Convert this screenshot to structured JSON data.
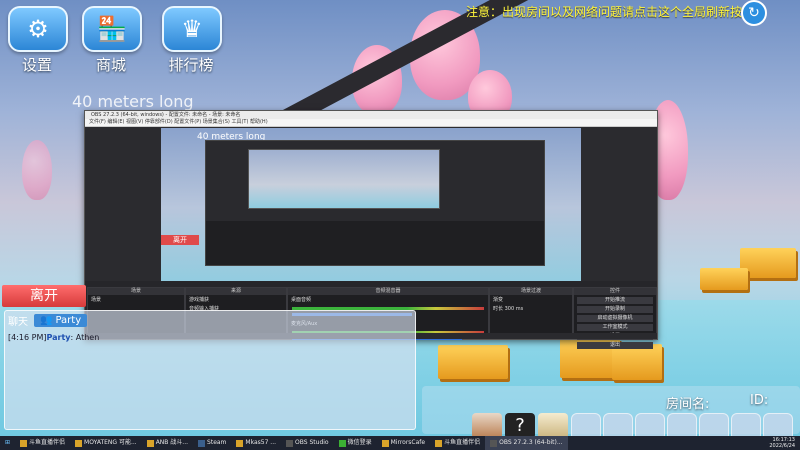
{
  "top_buttons": [
    {
      "label": "设置",
      "icon": "gear-icon"
    },
    {
      "label": "商城",
      "icon": "shop-icon"
    },
    {
      "label": "排行榜",
      "icon": "crown-icon"
    }
  ],
  "notice": "注意：出现房间以及网络问题请点击这个全局刷新按钮",
  "background_text": "40 meters long",
  "obs": {
    "title": "OBS 27.2.3 (64-bit, windows) - 配置文件: 未命名 - 场景: 未命名",
    "menu": "文件(F)  编辑(E)  视图(V)  停靠部件(D)  配置文件(P)  场景集合(S)  工具(T)  帮助(H)",
    "inner_bg_text": "40 meters long",
    "leave_small": "离开",
    "docks": {
      "scenes_title": "场景",
      "scene_item": "场景",
      "sources_title": "来源",
      "source_items": [
        "游戏捕获",
        "音频输入捕获"
      ],
      "mixer_title": "音频混音器",
      "mixer_items": [
        "桌面音频",
        "麦克风/Aux"
      ],
      "transitions_title": "场景过渡",
      "transition_type": "渐变",
      "duration_label": "时长",
      "duration_value": "300 ms",
      "controls_title": "控件",
      "control_buttons": [
        "开始推流",
        "开始录制",
        "启动虚拟摄像机",
        "工作室模式",
        "设置",
        "退出"
      ]
    }
  },
  "chat": {
    "leave_label": "离开",
    "tab_chat": "聊天",
    "tab_party": "Party",
    "message_time": "[4:16 PM]",
    "message_channel": "Party",
    "message_text": ": Athen"
  },
  "room": {
    "name_label": "房间名:",
    "id_label": "ID:"
  },
  "taskbar": {
    "items": [
      "斗鱼直播伴侣",
      "MOYATENG 可能...",
      "ANB  战斗...",
      "Steam",
      "Mkas57 ...",
      "OBS Studio",
      "微信登录",
      "MirrorsCafe",
      "斗鱼直播伴侣",
      "OBS 27.2.3 (64-bit)..."
    ],
    "time": "16:17:13",
    "date": "2022/6/24"
  },
  "colors": {
    "accent_blue": "#2c86d6",
    "leave_red": "#d63a3a",
    "notice_yellow": "#fff53a"
  }
}
